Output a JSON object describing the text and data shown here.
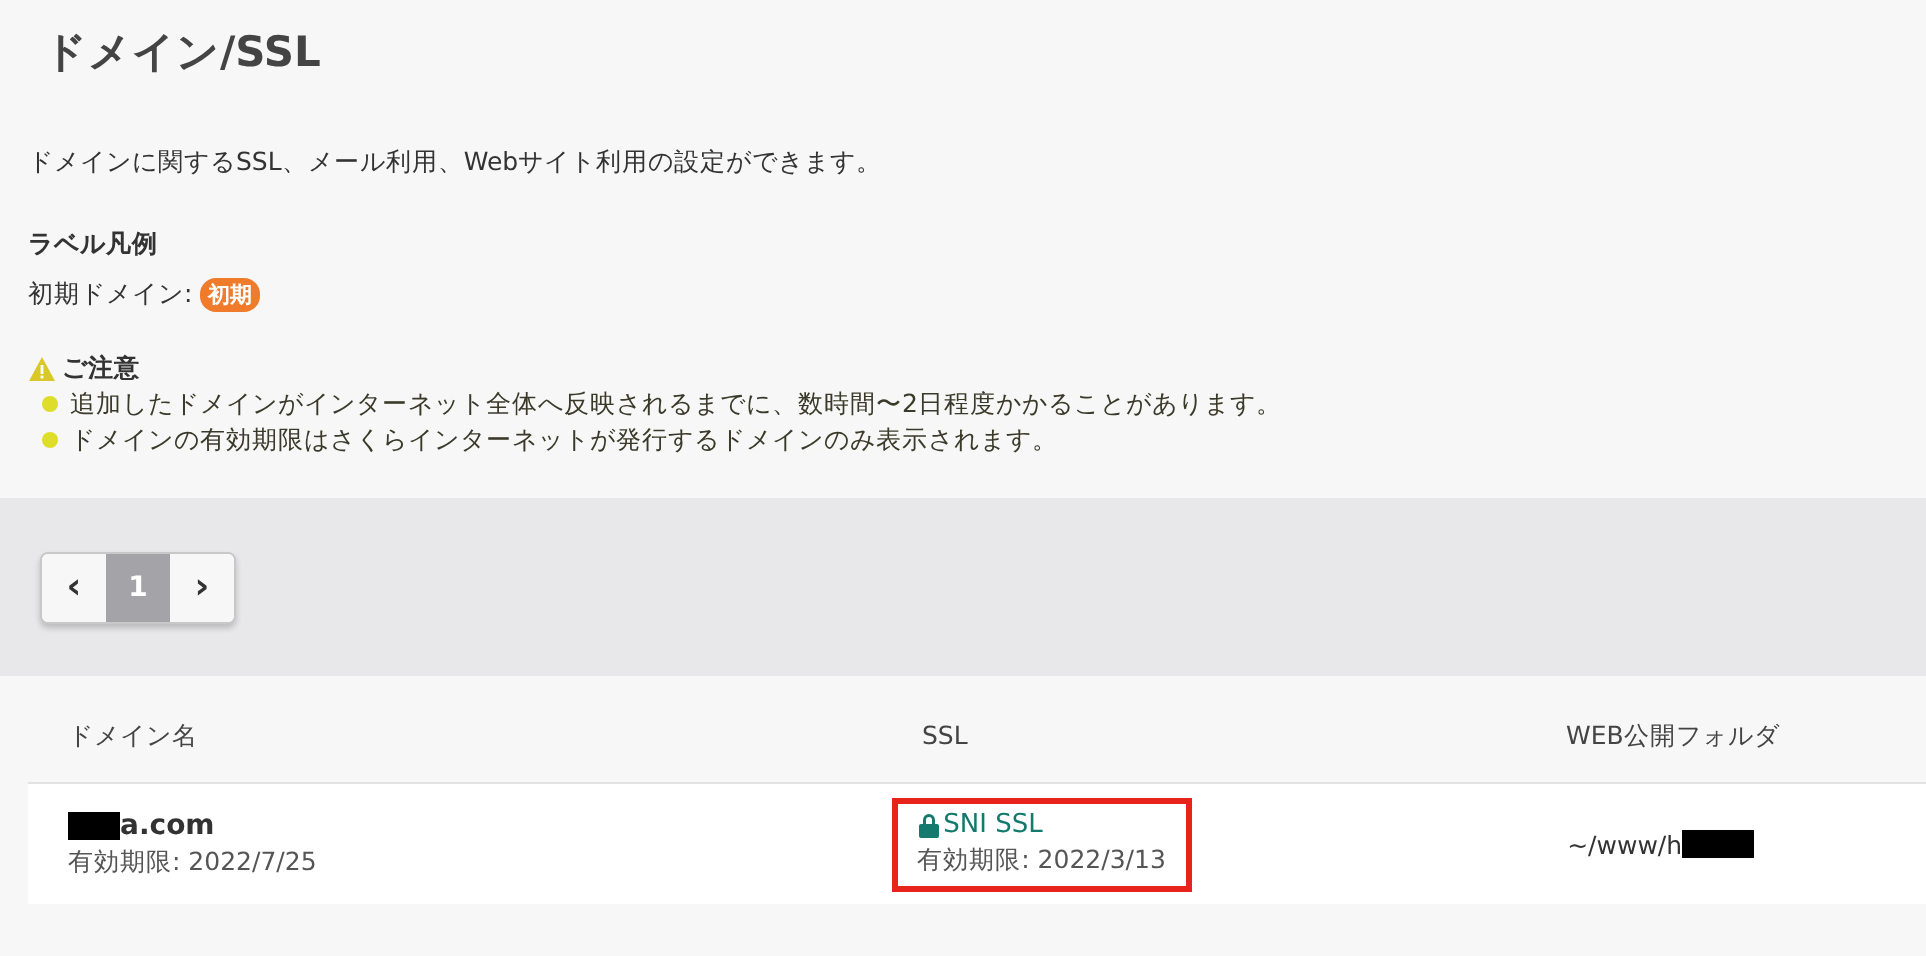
{
  "title": "ドメイン/SSL",
  "description": "ドメインに関するSSL、メール利用、Webサイト利用の設定ができます。",
  "legend": {
    "heading": "ラベル凡例",
    "label": "初期ドメイン:",
    "badge": "初期"
  },
  "notice": {
    "heading": "ご注意",
    "items": [
      "追加したドメインがインターネット全体へ反映されるまでに、数時間〜2日程度かかることがあります。",
      "ドメインの有効期限はさくらインターネットが発行するドメインのみ表示されます。"
    ]
  },
  "pagination": {
    "prev": "‹",
    "next": "›",
    "pages": [
      {
        "label": "1",
        "selected": true
      }
    ]
  },
  "table": {
    "columns": [
      "ドメイン名",
      "SSL",
      "WEB公開フォルダ"
    ],
    "rows": [
      {
        "domain": "a.com",
        "domain_expiry": "有効期限: 2022/7/25",
        "ssl": "SNI SSL",
        "ssl_expiry": "有効期限: 2022/3/13",
        "folder": "~/www/h"
      }
    ]
  }
}
